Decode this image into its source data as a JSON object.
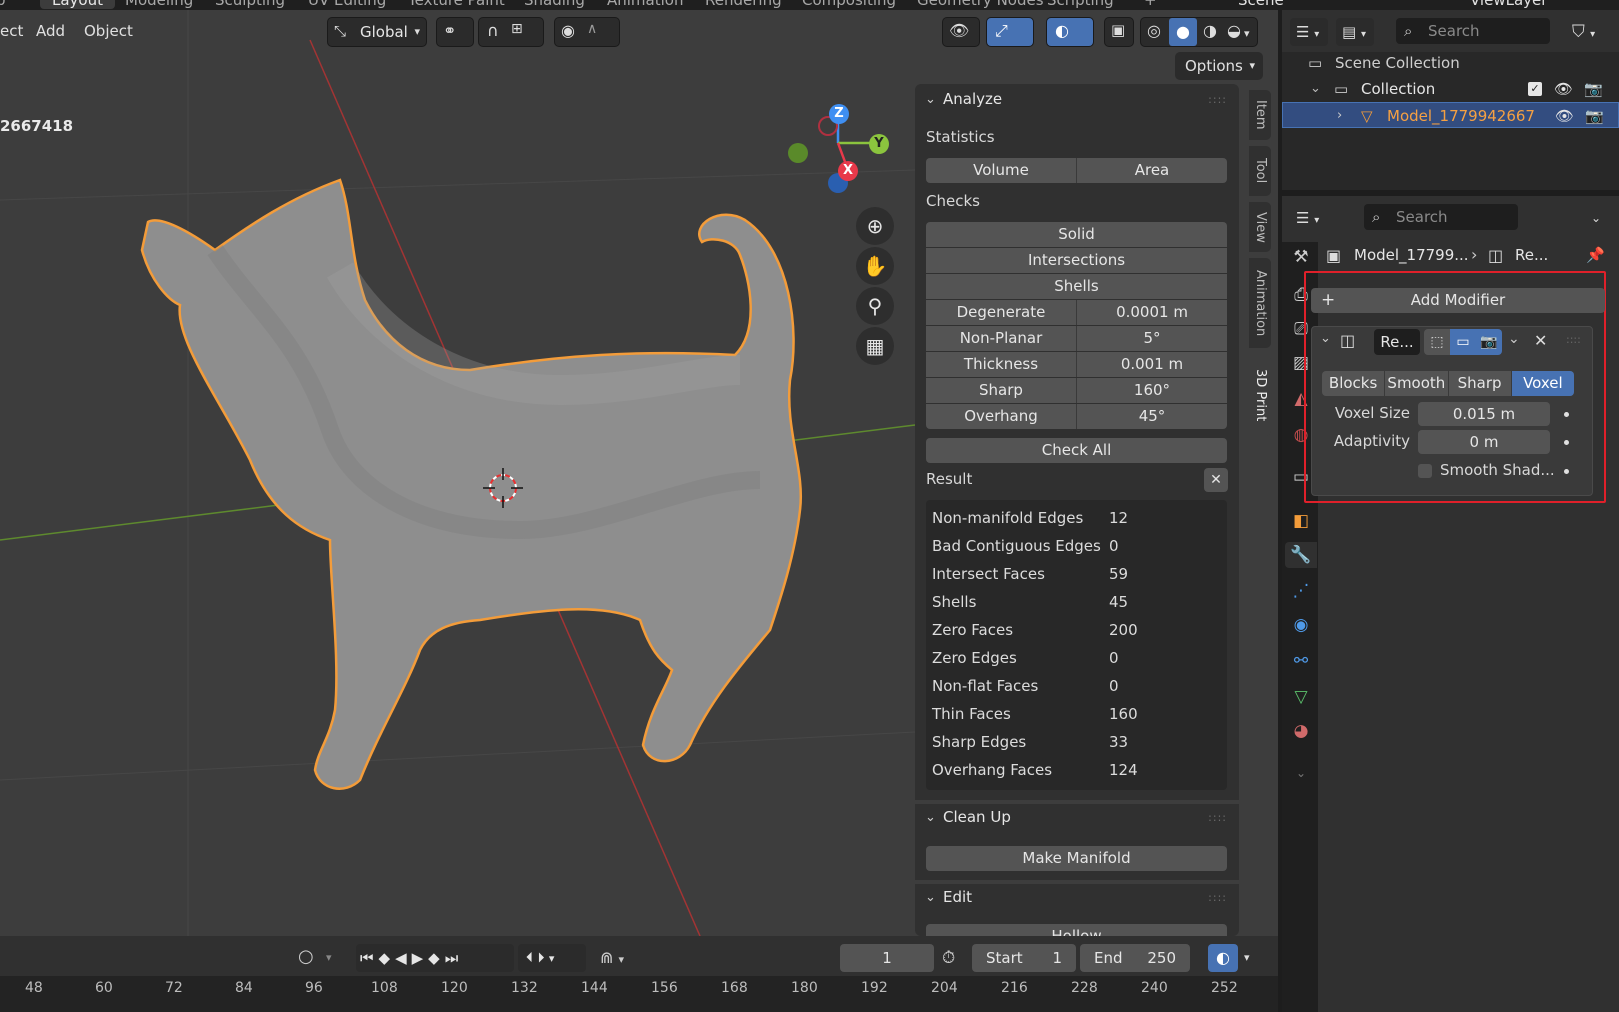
{
  "top_tabs": [
    "p",
    "Layout",
    "Modeling",
    "Sculpting",
    "UV Editing",
    "Texture Paint",
    "Shading",
    "Animation",
    "Rendering",
    "Compositing",
    "Geometry Nodes",
    "Scripting",
    "+"
  ],
  "scene_name": "Scene",
  "view_layer": "ViewLayer",
  "viewport_header": {
    "menus": [
      "ect",
      "Add",
      "Object"
    ],
    "orientation": "Global",
    "options_label": "Options"
  },
  "object_info_text": "2667418",
  "gizmo_axes": {
    "z": "Z",
    "y": "Y",
    "x": "X"
  },
  "side_tabs": [
    "Item",
    "Tool",
    "View",
    "Animation",
    "3D Print"
  ],
  "analyze": {
    "title": "Analyze",
    "statistics_label": "Statistics",
    "volume": "Volume",
    "area": "Area",
    "checks_label": "Checks",
    "solid": "Solid",
    "intersections": "Intersections",
    "shells": "Shells",
    "params": [
      {
        "label": "Degenerate",
        "value": "0.0001 m"
      },
      {
        "label": "Non-Planar",
        "value": "5°"
      },
      {
        "label": "Thickness",
        "value": "0.001 m"
      },
      {
        "label": "Sharp",
        "value": "160°"
      },
      {
        "label": "Overhang",
        "value": "45°"
      }
    ],
    "check_all": "Check All",
    "result_label": "Result",
    "results": [
      {
        "label": "Non-manifold Edges",
        "value": "12"
      },
      {
        "label": "Bad Contiguous Edges",
        "value": "0"
      },
      {
        "label": "Intersect Faces",
        "value": "59"
      },
      {
        "label": "Shells",
        "value": "45"
      },
      {
        "label": "Zero Faces",
        "value": "200"
      },
      {
        "label": "Zero Edges",
        "value": "0"
      },
      {
        "label": "Non-flat Faces",
        "value": "0"
      },
      {
        "label": "Thin Faces",
        "value": "160"
      },
      {
        "label": "Sharp Edges",
        "value": "33"
      },
      {
        "label": "Overhang Faces",
        "value": "124"
      }
    ]
  },
  "cleanup": {
    "title": "Clean Up",
    "make_manifold": "Make Manifold"
  },
  "edit": {
    "title": "Edit",
    "hollow": "Hollow"
  },
  "timeline": {
    "current_frame": "1",
    "start_label": "Start",
    "start_value": "1",
    "end_label": "End",
    "end_value": "250",
    "ruler": [
      "48",
      "60",
      "72",
      "84",
      "96",
      "108",
      "120",
      "132",
      "144",
      "156",
      "168",
      "180",
      "192",
      "204",
      "216",
      "228",
      "240",
      "252"
    ]
  },
  "outliner": {
    "search_placeholder": "Search",
    "scene_collection": "Scene Collection",
    "collection": "Collection",
    "model": "Model_1779942667"
  },
  "properties": {
    "search_placeholder": "Search",
    "breadcrumb_object": "Model_17799...",
    "breadcrumb_modifier": "Re...",
    "add_modifier": "Add Modifier",
    "modifier_name": "Re...",
    "modes": [
      "Blocks",
      "Smooth",
      "Sharp",
      "Voxel"
    ],
    "active_mode": "Voxel",
    "voxel_size_label": "Voxel Size",
    "voxel_size_value": "0.015 m",
    "adaptivity_label": "Adaptivity",
    "adaptivity_value": "0 m",
    "smooth_shading_label": "Smooth Shad..."
  },
  "colors": {
    "selection_orange": "#f39c3a",
    "highlight_red": "#e0202a",
    "active_blue": "#4772b3",
    "axis_x": "#e8394a",
    "axis_y": "#8bc43e",
    "axis_z": "#3f8ff2"
  }
}
